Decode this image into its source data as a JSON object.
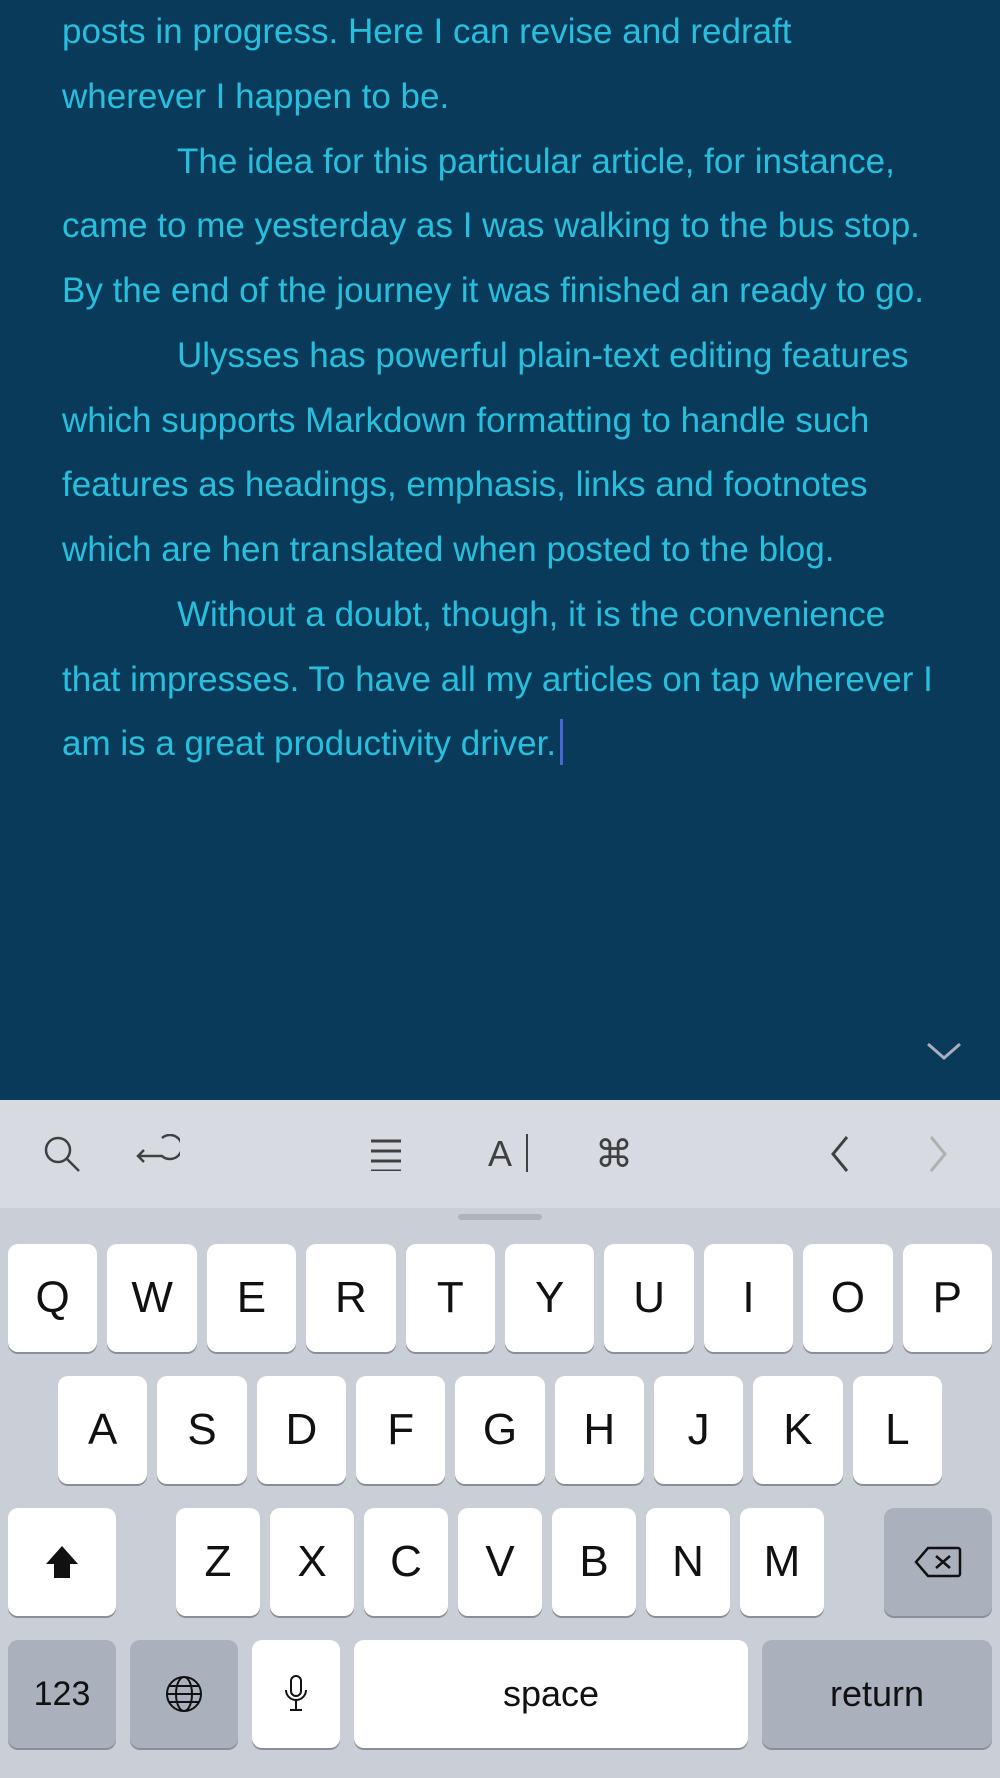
{
  "editor": {
    "p1": "posts in progress. Here I can revise and redraft wherever I happen to be.",
    "p2": "The idea for this particular article, for instance, came to me yesterday as I was walking to the bus stop. By the end of the journey it was finished an ready to go.",
    "p3": "Ulysses has powerful plain-text editing features which supports Markdown formatting to handle such features as headings, emphasis, links and footnotes which are hen translated when posted to the blog.",
    "p4": "Without a doubt, though, it is the convenience that impresses. To have all my articles on tap wherever I am is a great productivity driver."
  },
  "toolbar": {
    "a_label": "A",
    "cmd_symbol": "⌘"
  },
  "keyboard": {
    "row1": [
      "Q",
      "W",
      "E",
      "R",
      "T",
      "Y",
      "U",
      "I",
      "O",
      "P"
    ],
    "row2": [
      "A",
      "S",
      "D",
      "F",
      "G",
      "H",
      "J",
      "K",
      "L"
    ],
    "row3": [
      "Z",
      "X",
      "C",
      "V",
      "B",
      "N",
      "M"
    ],
    "numkey": "123",
    "space": "space",
    "return": "return"
  }
}
